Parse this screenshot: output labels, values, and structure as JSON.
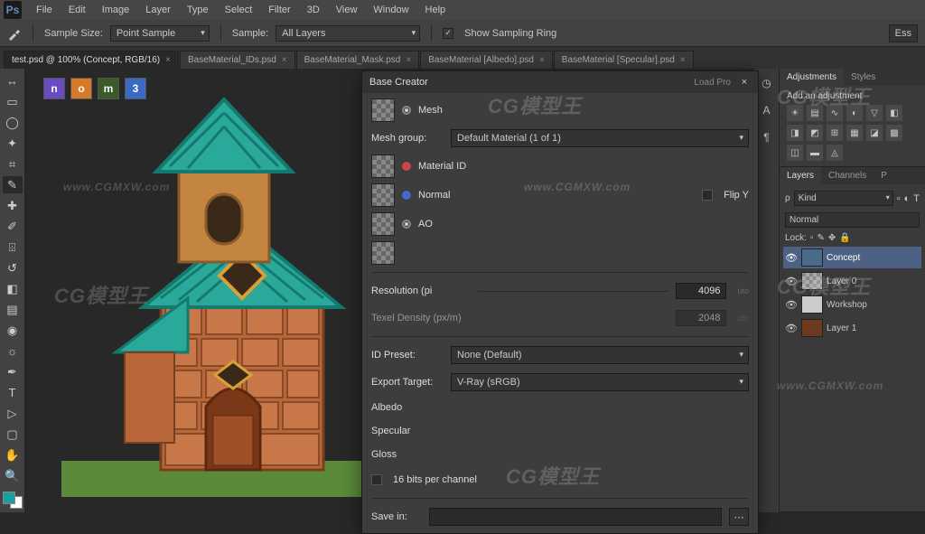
{
  "menu": {
    "items": [
      "File",
      "Edit",
      "Image",
      "Layer",
      "Type",
      "Select",
      "Filter",
      "3D",
      "View",
      "Window",
      "Help"
    ]
  },
  "options": {
    "sample_size_label": "Sample Size:",
    "sample_size_value": "Point Sample",
    "sample_label": "Sample:",
    "sample_value": "All Layers",
    "ring_label": "Show Sampling Ring",
    "ess": "Ess"
  },
  "tabs": [
    {
      "label": "test.psd @ 100% (Concept, RGB/16)",
      "active": true
    },
    {
      "label": "BaseMaterial_IDs.psd",
      "active": false
    },
    {
      "label": "BaseMaterial_Mask.psd",
      "active": false
    },
    {
      "label": "BaseMaterial [Albedo].psd",
      "active": false
    },
    {
      "label": "BaseMaterial [Specular].psd",
      "active": false
    }
  ],
  "ext_icons": [
    "n",
    "o",
    "m",
    "3"
  ],
  "panels": {
    "adjustments_tab": "Adjustments",
    "styles_tab": "Styles",
    "add_adjustment": "Add an adjustment",
    "layers_tab": "Layers",
    "channels_tab": "Channels",
    "paths_tab": "P",
    "kind_label": "Kind",
    "blend_mode": "Normal",
    "lock_label": "Lock:",
    "layers_list": [
      {
        "name": "Concept",
        "active": true,
        "color": "#4a6a8a"
      },
      {
        "name": "Layer 0",
        "active": false,
        "color": "#888"
      },
      {
        "name": "Workshop",
        "active": false,
        "color": "#999"
      },
      {
        "name": "Layer 1",
        "active": false,
        "color": "#6b3a1f"
      }
    ]
  },
  "dialog": {
    "title": "Base Creator",
    "load_link": "Load Pro",
    "mesh": "Mesh",
    "mesh_group_label": "Mesh group:",
    "mesh_group_value": "Default Material (1 of 1)",
    "material_id": "Material ID",
    "normal": "Normal",
    "flip_y": "Flip Y",
    "ao": "AO",
    "resolution_label": "Resolution (pi",
    "resolution_value": "4096",
    "resolution_auto": "uto",
    "texel_label": "Texel Density (px/m)",
    "texel_value": "2048",
    "texel_auto": "uto",
    "id_preset_label": "ID Preset:",
    "id_preset_value": "None (Default)",
    "export_target_label": "Export Target:",
    "export_target_value": "V-Ray (sRGB)",
    "albedo": "Albedo",
    "specular": "Specular",
    "gloss": "Gloss",
    "bits_label": "16 bits per channel",
    "save_in_label": "Save in:"
  },
  "watermarks": [
    "CG模型王",
    "www.CGMXW.com"
  ]
}
